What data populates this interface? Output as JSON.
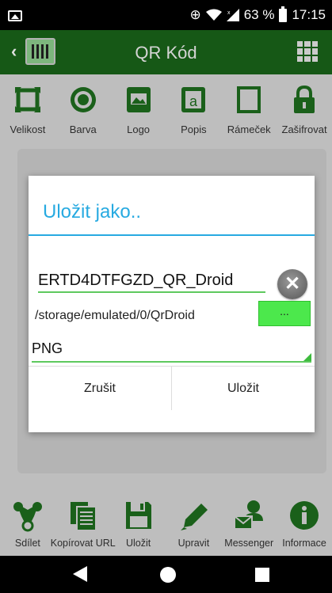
{
  "status_bar": {
    "battery_percent": "63 %",
    "time": "17:15",
    "icons": [
      "image-icon",
      "data-saver-icon",
      "wifi-icon",
      "signal-icon",
      "battery-icon"
    ]
  },
  "app_bar": {
    "title": "QR Kód",
    "icons": [
      "back-icon",
      "app-logo-icon",
      "grid-menu-icon"
    ]
  },
  "toolbar": {
    "items": [
      {
        "label": "Velikost",
        "icon": "resize-icon"
      },
      {
        "label": "Barva",
        "icon": "color-target-icon"
      },
      {
        "label": "Logo",
        "icon": "logo-image-icon"
      },
      {
        "label": "Popis",
        "icon": "text-description-icon"
      },
      {
        "label": "Rámeček",
        "icon": "frame-icon"
      },
      {
        "label": "Zašifrovat",
        "icon": "lock-icon"
      }
    ]
  },
  "bottom_bar": {
    "items": [
      {
        "label": "Sdílet",
        "icon": "share-icon"
      },
      {
        "label": "Kopírovat URL",
        "icon": "copy-icon"
      },
      {
        "label": "Uložit",
        "icon": "save-icon"
      },
      {
        "label": "Upravit",
        "icon": "edit-pencil-icon"
      },
      {
        "label": "Messenger",
        "icon": "messenger-icon"
      },
      {
        "label": "Informace",
        "icon": "info-icon"
      }
    ]
  },
  "dialog": {
    "title": "Uložit jako..",
    "filename": "ERTD4DTFGZD_QR_Droid",
    "path": "/storage/emulated/0/QrDroid",
    "browse_label": "...",
    "format": "PNG",
    "cancel_label": "Zrušit",
    "save_label": "Uložit"
  },
  "colors": {
    "app_bar": "#1a651a",
    "accent": "#27aae1",
    "icon_green": "#1e6e1e",
    "browse_button": "#4ce84c"
  }
}
